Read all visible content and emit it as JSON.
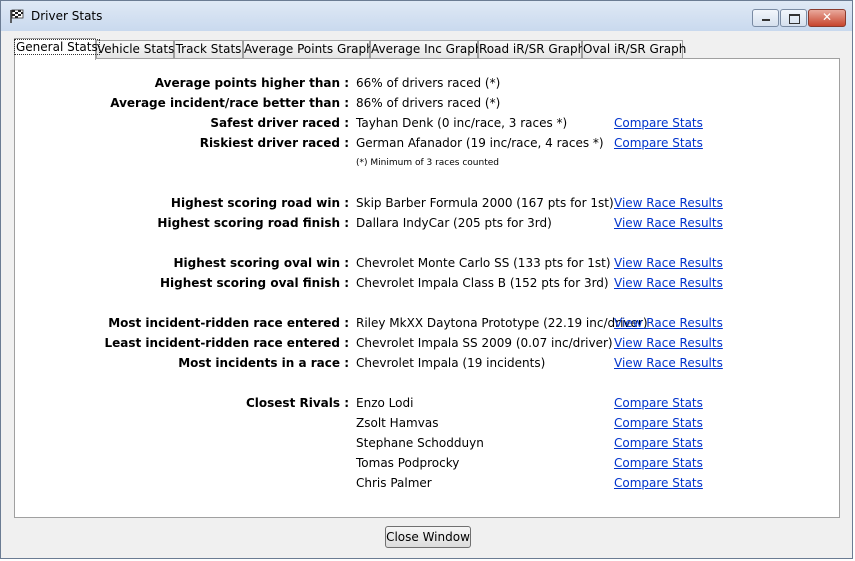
{
  "window": {
    "title": "Driver Stats"
  },
  "tabs": [
    "General Stats",
    "Vehicle Stats",
    "Track Stats",
    "Average Points Graph",
    "Average Inc Graph",
    "Road iR/SR Graph",
    "Oval iR/SR Graph"
  ],
  "stats": {
    "avg_points": {
      "label": "Average points higher than :",
      "value": "66% of drivers raced (*)"
    },
    "avg_incident": {
      "label": "Average incident/race better than :",
      "value": "86% of drivers raced (*)"
    },
    "safest": {
      "label": "Safest driver raced :",
      "value": "Tayhan Denk (0 inc/race, 3 races *)",
      "link": "Compare Stats"
    },
    "riskiest": {
      "label": "Riskiest driver raced :",
      "value": "German Afanador (19 inc/race, 4 races *)",
      "link": "Compare Stats"
    },
    "footnote": "(*) Minimum of 3 races counted",
    "road_win": {
      "label": "Highest scoring road win :",
      "value": "Skip Barber Formula 2000 (167 pts for 1st)",
      "link": "View Race Results"
    },
    "road_finish": {
      "label": "Highest scoring road finish :",
      "value": "Dallara IndyCar (205 pts for 3rd)",
      "link": "View Race Results"
    },
    "oval_win": {
      "label": "Highest scoring oval win :",
      "value": "Chevrolet Monte Carlo SS (133 pts for 1st)",
      "link": "View Race Results"
    },
    "oval_finish": {
      "label": "Highest scoring oval finish :",
      "value": "Chevrolet Impala Class B (152 pts for 3rd)",
      "link": "View Race Results"
    },
    "most_incident_race": {
      "label": "Most incident-ridden race entered :",
      "value": "Riley MkXX Daytona Prototype (22.19 inc/driver)",
      "link": "View Race Results"
    },
    "least_incident_race": {
      "label": "Least incident-ridden race entered :",
      "value": "Chevrolet Impala SS 2009 (0.07 inc/driver)",
      "link": "View Race Results"
    },
    "most_incidents": {
      "label": "Most incidents in a race :",
      "value": "Chevrolet Impala (19 incidents)",
      "link": "View Race Results"
    }
  },
  "rivals": {
    "label": "Closest Rivals :",
    "link": "Compare Stats",
    "names": [
      "Enzo Lodi",
      "Zsolt Hamvas",
      "Stephane Schodduyn",
      "Tomas Podprocky",
      "Chris Palmer"
    ]
  },
  "footer": {
    "close_label": "Close Window"
  }
}
